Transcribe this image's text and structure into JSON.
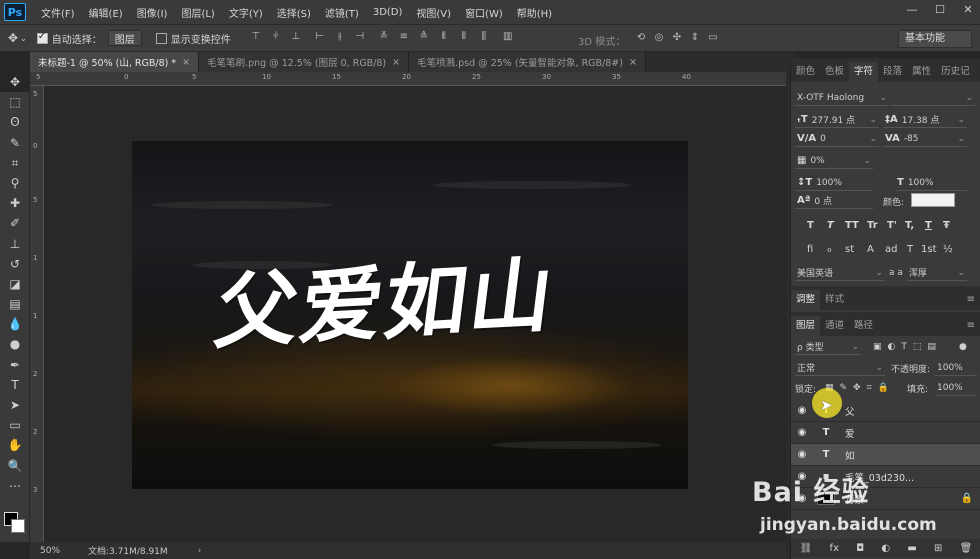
{
  "app": {
    "logo": "Ps"
  },
  "menubar": {
    "items": [
      "文件(F)",
      "编辑(E)",
      "图像(I)",
      "图层(L)",
      "文字(Y)",
      "选择(S)",
      "滤镜(T)",
      "3D(D)",
      "视图(V)",
      "窗口(W)",
      "帮助(H)"
    ]
  },
  "window_controls": {
    "minimize": "—",
    "maximize": "☐",
    "close": "✕"
  },
  "options": {
    "auto_select_label": "自动选择：",
    "auto_select_value": "图层",
    "show_transform_label": "显示变换控件",
    "mode3d_label": "3D 模式：",
    "workspace": "基本功能"
  },
  "tabs": [
    {
      "label": "未标题-1 @ 50% (山, RGB/8) *",
      "active": true
    },
    {
      "label": "毛笔笔刷.png @ 12.5% (图层 0, RGB/8)",
      "active": false
    },
    {
      "label": "毛笔喷溅.psd @ 25% (矢量智能对象, RGB/8#)",
      "active": false
    }
  ],
  "rulers": {
    "top": [
      "5",
      "0",
      "5",
      "10",
      "15",
      "20",
      "25",
      "30",
      "35",
      "40"
    ],
    "left": [
      "5",
      "0",
      "5",
      "1",
      "1",
      "2",
      "2",
      "3"
    ]
  },
  "canvas": {
    "headline": "父爱如山"
  },
  "status": {
    "zoom": "50%",
    "doc_info": "文档:3.71M/8.91M",
    "arrow": "›"
  },
  "panels": {
    "top_tabs": [
      "颜色",
      "色板",
      "字符",
      "段落",
      "属性",
      "历史记"
    ],
    "active_top_tab": "字符",
    "character": {
      "font": "X-OTF Haolong",
      "size": "277.91 点",
      "leading": "17.38 点",
      "kerning": "0",
      "tracking": "-85",
      "vertical_scale_pct": "0%",
      "vscale": "100%",
      "hscale": "100%",
      "baseline": "0 点",
      "color_label": "颜色:",
      "style_buttons": [
        "T",
        "T",
        "TT",
        "Tr",
        "T'",
        "T,",
        "T",
        "Ŧ"
      ],
      "opentype_buttons": [
        "fi",
        "ℴ",
        "st",
        "A",
        "ad",
        "T",
        "1st",
        "½"
      ],
      "language": "美国英语",
      "antialias": "浑厚",
      "aa_label": "a a"
    },
    "mid_tabs": [
      "调整",
      "样式"
    ],
    "layer_tabs": [
      "图层",
      "通道",
      "路径"
    ],
    "layers_panel": {
      "filter_kind": "ρ 类型",
      "blend_mode": "正常",
      "opacity_label": "不透明度:",
      "opacity": "100%",
      "lock_label": "锁定:",
      "fill_label": "填充:",
      "fill": "100%",
      "layers": [
        {
          "thumb": "T",
          "name": "父",
          "selected": false
        },
        {
          "thumb": "T",
          "name": "爱",
          "selected": false
        },
        {
          "thumb": "T",
          "name": "如",
          "selected": true
        },
        {
          "thumb": "▪",
          "name": "毛笔_03d230...",
          "selected": false
        },
        {
          "thumb": "■",
          "name": "背景",
          "selected": false
        }
      ]
    }
  },
  "watermark": {
    "brand": "Bai 经验",
    "url": "jingyan.baidu.com"
  }
}
